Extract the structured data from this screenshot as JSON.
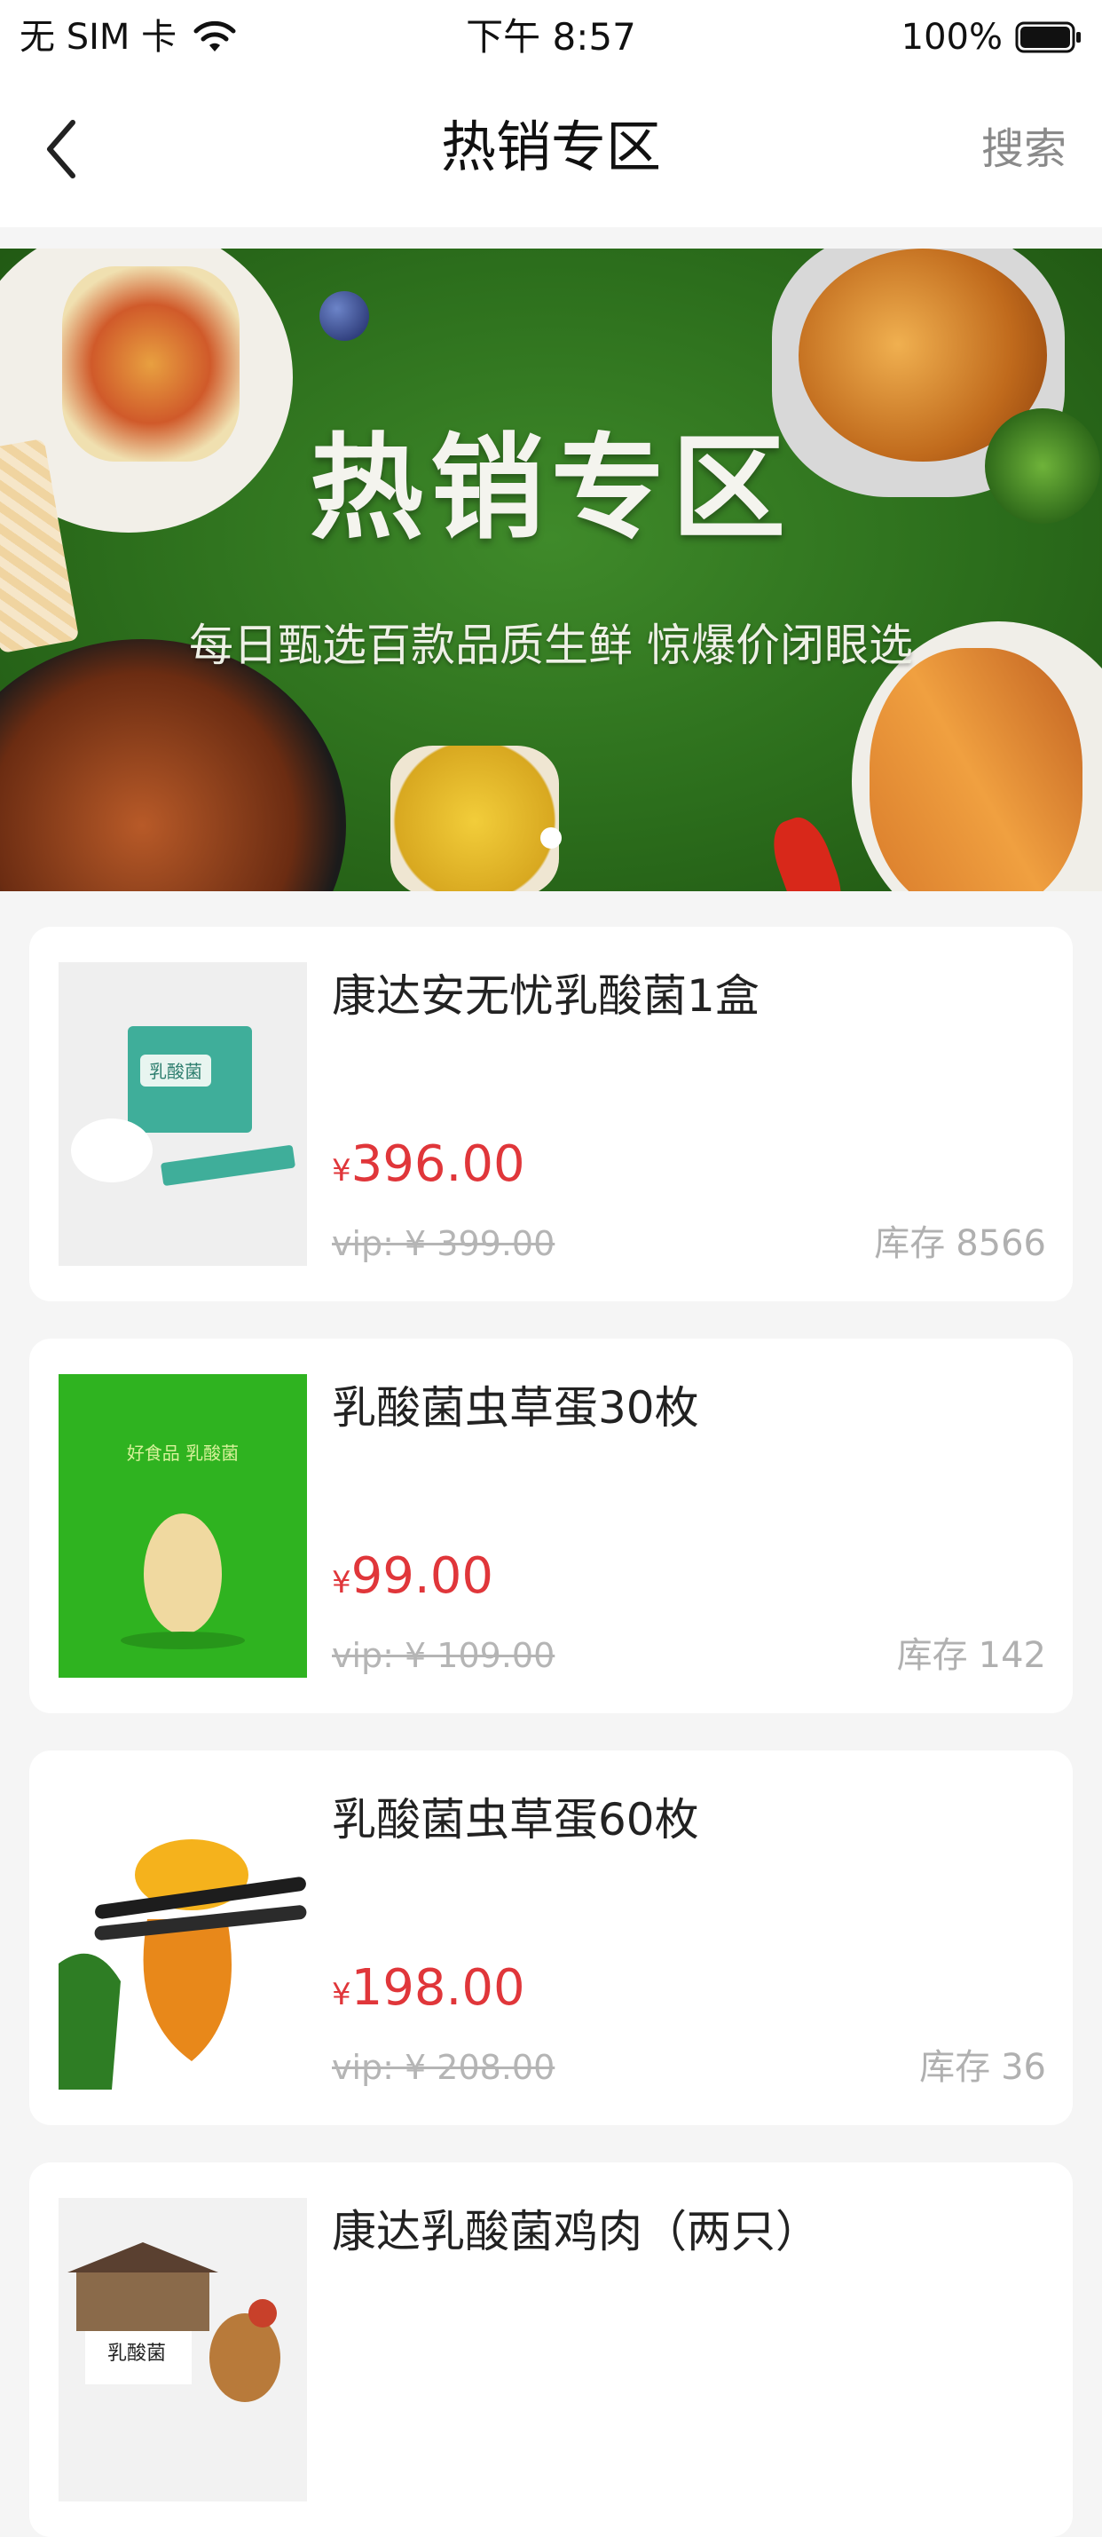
{
  "status_bar": {
    "carrier": "无 SIM 卡",
    "time": "下午 8:57",
    "battery_percent": "100%",
    "battery_level": 1.0
  },
  "nav": {
    "title": "热销专区",
    "search_label": "搜索"
  },
  "banner": {
    "title": "热销专区",
    "subtitle": "每日甄选百款品质生鲜 惊爆价闭眼选",
    "page_count": 1,
    "current_page": 1
  },
  "products": [
    {
      "name": "康达安无忧乳酸菌1盒",
      "price_symbol": "¥",
      "price": "396.00",
      "vip_price": "vip: ¥ 399.00",
      "stock_label": "库存",
      "stock": "8566",
      "image_text": "乳酸菌"
    },
    {
      "name": "乳酸菌虫草蛋30枚",
      "price_symbol": "¥",
      "price": "99.00",
      "vip_price": "vip: ¥ 109.00",
      "stock_label": "库存",
      "stock": "142",
      "image_text": "好食品 乳酸菌"
    },
    {
      "name": "乳酸菌虫草蛋60枚",
      "price_symbol": "¥",
      "price": "198.00",
      "vip_price": "vip: ¥ 208.00",
      "stock_label": "库存",
      "stock": "36",
      "image_text": ""
    },
    {
      "name": "康达乳酸菌鸡肉（两只）",
      "price_symbol": "",
      "price": "",
      "vip_price": "",
      "stock_label": "",
      "stock": "",
      "image_text": "乳酸菌"
    }
  ],
  "colors": {
    "accent_price": "#e0363a",
    "page_background": "#f5f5f5",
    "muted_text": "#b0b0b0",
    "banner_green": "#2c6e1c"
  },
  "icons": {
    "back": "chevron-left-icon",
    "wifi": "wifi-icon",
    "battery": "battery-icon"
  }
}
